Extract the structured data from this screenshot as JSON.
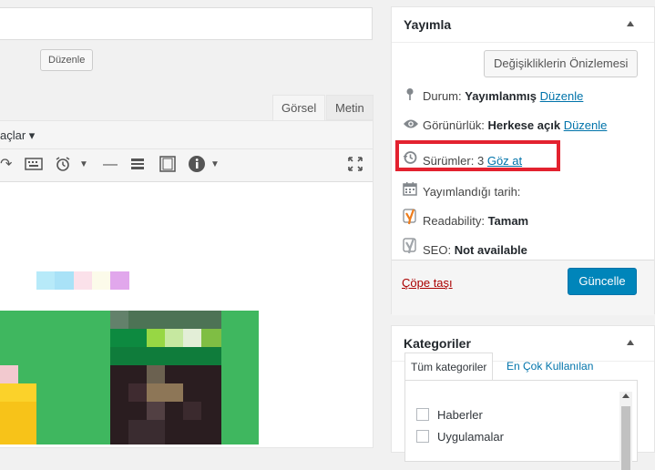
{
  "editor": {
    "edit_slug_label": "Düzenle",
    "tabs": {
      "visual": "Görsel",
      "text": "Metin"
    },
    "tools_label": "açlar ▾"
  },
  "publish": {
    "title": "Yayımla",
    "preview_button": "Değişikliklerin Önizlemesi",
    "status_label": "Durum:",
    "status_value": "Yayımlanmış",
    "status_edit": "Düzenle",
    "visibility_label": "Görünürlük:",
    "visibility_value": "Herkese açık",
    "visibility_edit": "Düzenle",
    "revisions_label": "Sürümler:",
    "revisions_count": "3",
    "revisions_browse": "Göz at",
    "published_date_label": "Yayımlandığı tarih:",
    "readability_label": "Readability:",
    "readability_value": "Tamam",
    "seo_label": "SEO:",
    "seo_value": "Not available",
    "trash_link": "Çöpe taşı",
    "update_button": "Güncelle"
  },
  "categories": {
    "title": "Kategoriler",
    "tab_all": "Tüm kategoriler",
    "tab_most_used": "En Çok Kullanılan",
    "items": [
      {
        "label": "Haberler"
      },
      {
        "label": "Uygulamalar"
      }
    ]
  },
  "colors": {
    "accent": "#0073aa",
    "primary_button": "#0085ba",
    "highlight_box": "#e3222f",
    "trash": "#a00000"
  }
}
